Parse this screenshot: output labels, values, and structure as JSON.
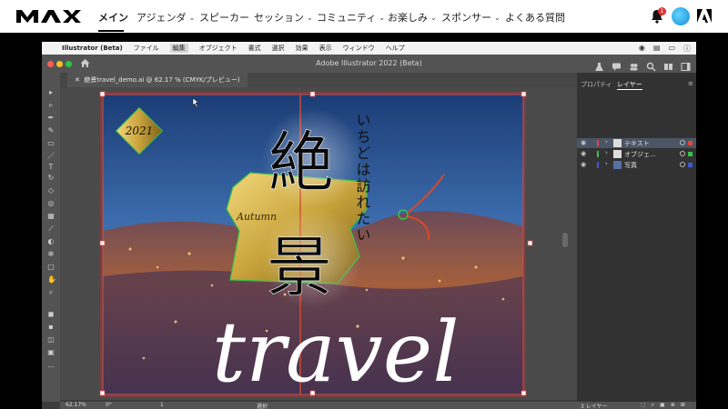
{
  "site_nav": {
    "items": [
      {
        "label": "メイン",
        "active": true,
        "has_menu": false
      },
      {
        "label": "アジェンダ",
        "active": false,
        "has_menu": true
      },
      {
        "label": "スピーカー",
        "active": false,
        "has_menu": false
      },
      {
        "label": "セッション",
        "active": false,
        "has_menu": true
      },
      {
        "label": "コミュニティ",
        "active": false,
        "has_menu": true
      },
      {
        "label": "お楽しみ",
        "active": false,
        "has_menu": true
      },
      {
        "label": "スポンサー",
        "active": false,
        "has_menu": true
      },
      {
        "label": "よくある質問",
        "active": false,
        "has_menu": false
      }
    ],
    "notification_count": "1",
    "icons": {
      "logo": "max-logo",
      "bell": "bell-icon",
      "avatar": "avatar",
      "adobe": "adobe-logo-icon"
    }
  },
  "app": {
    "menu": [
      "Illustrator (Beta)",
      "ファイル",
      "編集",
      "オブジェクト",
      "書式",
      "選択",
      "効果",
      "表示",
      "ウィンドウ",
      "ヘルプ"
    ],
    "window_title": "Adobe Illustrator 2022 (Beta)",
    "doc_tab": "絶景travel_demo.ai @ 62.17 % (CMYK/プレビュー)",
    "panel_tabs": [
      "プロパティ",
      "レイヤー"
    ],
    "layers": [
      {
        "name": "テキスト",
        "color": "#e0473f",
        "selected": true
      },
      {
        "name": "オブジェ...",
        "color": "#35c24a",
        "selected": false
      },
      {
        "name": "写真",
        "color": "#3c5bd6",
        "selected": false
      }
    ],
    "panel_footer": "3 レイヤー",
    "status": {
      "zoom": "62.17%",
      "rotation": "0°",
      "artboard": "1",
      "mode": "選択"
    }
  },
  "artwork": {
    "year": "2021",
    "autumn": "Autumn",
    "kanji_top": "絶",
    "kanji_bottom": "景",
    "vertical_text": "いちどは訪れたい",
    "script": "travel"
  },
  "colors": {
    "accent": "#000000",
    "badge": "#e03131",
    "sky_top": "#1c3f78",
    "tag_gold": "#c9a43c"
  }
}
